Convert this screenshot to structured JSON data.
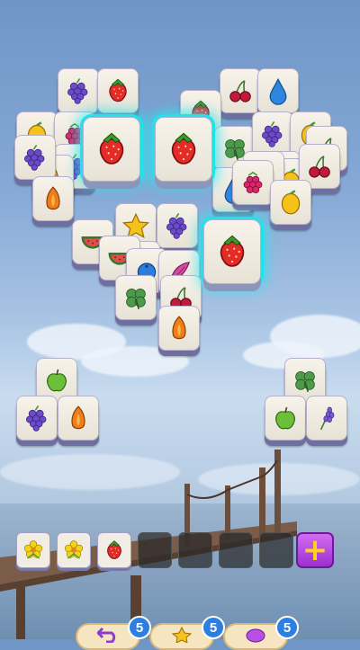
{
  "colors": {
    "tile_face": "#f3efe6",
    "tile_shadow": "#6e6fa0",
    "glow": "#20e3e9",
    "add_slot_button": "#b94fe3",
    "counter_badge": "#2c7fe0"
  },
  "heart_tiles": [
    "grapes",
    "strawberry",
    "cherries",
    "drop",
    "strawberry",
    "lemon",
    "raspberry",
    "pear",
    "clover",
    "grapes",
    "lemon",
    "cherries",
    "grapes",
    "pear",
    "grapes",
    "lemon",
    "lemon",
    "cherries",
    "orange",
    "plum",
    "drop",
    "raspberry",
    "lemon",
    "watermelon",
    "star",
    "grapes",
    "drop",
    "watermelon",
    "blueberry",
    "feather",
    "clover",
    "cherries",
    "orange"
  ],
  "selected_tiles": [
    "strawberry",
    "strawberry",
    "strawberry"
  ],
  "left_pile": [
    "apple",
    "grapes",
    "orange"
  ],
  "right_pile": [
    "clover",
    "apple",
    "lavender"
  ],
  "slot_bar": {
    "slots": [
      "flower",
      "flower",
      "strawberry",
      "",
      "",
      "",
      ""
    ],
    "add_slot_icon": "plus-icon"
  },
  "boosters": [
    {
      "icon": "undo-icon",
      "count": "5"
    },
    {
      "icon": "magic-wand-icon",
      "count": "5"
    },
    {
      "icon": "shuffle-icon",
      "count": "5"
    }
  ]
}
